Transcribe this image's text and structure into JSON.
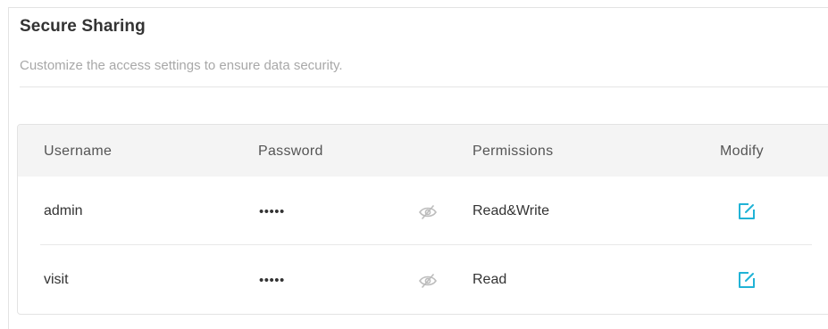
{
  "section": {
    "title": "Secure Sharing",
    "description": "Customize the access settings to ensure data security."
  },
  "table": {
    "headers": {
      "username": "Username",
      "password": "Password",
      "permissions": "Permissions",
      "modify": "Modify"
    },
    "rows": [
      {
        "username": "admin",
        "password": "•••••",
        "permissions": "Read&Write",
        "reveal_icon": "eye-slash-icon",
        "edit_icon": "edit-icon"
      },
      {
        "username": "visit",
        "password": "•••••",
        "permissions": "Read",
        "reveal_icon": "eye-slash-icon",
        "edit_icon": "edit-icon"
      }
    ]
  },
  "colors": {
    "accent": "#21b3d6",
    "header_bg": "#f4f4f4",
    "muted_text": "#a8a8a8",
    "icon_gray": "#bdbdbd"
  }
}
